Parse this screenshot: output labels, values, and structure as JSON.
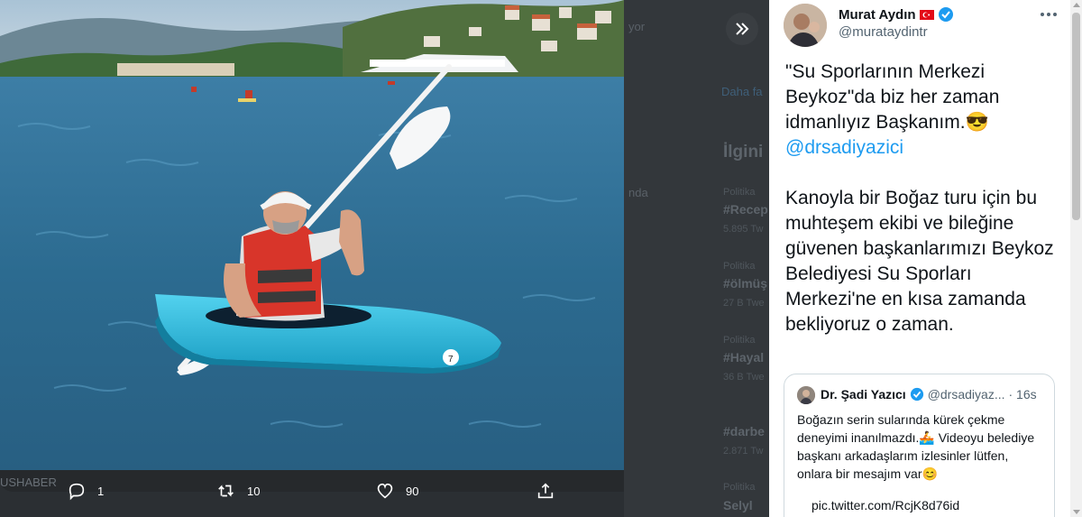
{
  "background": {
    "left_label": "USHABER",
    "trends": [
      {
        "category": "Politika",
        "tag": "#Recep",
        "count": "5.895 Tw"
      },
      {
        "category": "Politika",
        "tag": "#ölmüş",
        "count": "27 B Twe"
      },
      {
        "category": "Politika",
        "tag": "#Hayal",
        "count": "36 B Twe"
      },
      {
        "category": "",
        "tag": "#darbe",
        "count": "2.871 Tw"
      },
      {
        "category": "Politika",
        "tag": "Selyl",
        "count": ""
      }
    ],
    "heading": "İlgini",
    "partial_word_1": "Daha fa",
    "partial_word_2": "yor",
    "partial_word_3": "nda"
  },
  "actions": {
    "reply_count": "1",
    "retweet_count": "10",
    "like_count": "90"
  },
  "tweet": {
    "author_name": "Murat Aydın",
    "author_handle": "@murataydintr",
    "text_part1": "\"Su Sporlarının Merkezi Beykoz\"da biz her zaman idmanlıyız Başkanım.😎\n",
    "mention": "@drsadiyazici",
    "text_part2": "\n\nKanoyla bir Boğaz turu için bu muhteşem ekibi ve bileğine güvenen başkanlarımızı Beykoz Belediyesi Su Sporları Merkezi'ne en kısa zamanda bekliyoruz o zaman."
  },
  "quote": {
    "name": "Dr. Şadi Yazıcı",
    "handle": "@drsadiyaz...",
    "time": "· 16s",
    "text": "Boğazın serin sularında kürek çekme deneyimi inanılmazdı.🚣 Videoyu belediye başkanı arkadaşlarım izlesinler lütfen, onlara bir mesajım var😊",
    "link": "pic.twitter.com/RcjK8d76id"
  },
  "colors": {
    "accent": "#1d9bf0",
    "text": "#0f1419",
    "muted": "#536471",
    "kayak": "#2bb6d8",
    "water": "#2f6f93"
  },
  "icons": [
    "expand-chevrons-icon",
    "reply-icon",
    "retweet-icon",
    "like-icon",
    "share-icon",
    "verified-badge-icon",
    "turkey-flag-icon",
    "more-icon"
  ]
}
